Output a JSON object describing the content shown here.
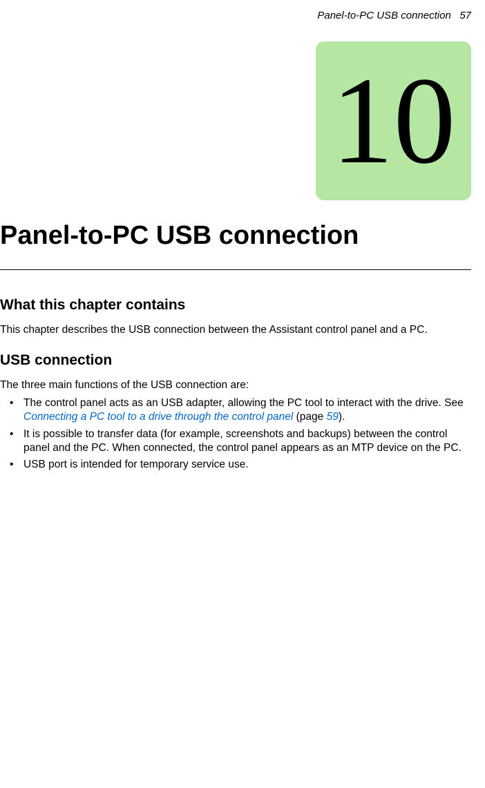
{
  "header": {
    "section_title": "Panel-to-PC USB connection",
    "page_number": "57"
  },
  "chapter": {
    "number": "10",
    "title": "Panel-to-PC USB connection"
  },
  "sections": {
    "what_contains": {
      "heading": "What this chapter contains",
      "body": "This chapter describes the USB connection between the Assistant control panel and a PC."
    },
    "usb_connection": {
      "heading": "USB connection",
      "intro": "The three main functions of the USB connection are:",
      "bullets": [
        {
          "pre": "The control panel acts as an USB adapter, allowing the PC tool to interact with the drive. See ",
          "link_text": "Connecting a PC tool to a drive through the control panel",
          "mid": " (page ",
          "link_page": "59",
          "post": ")."
        },
        {
          "text": "It is possible to transfer data (for example, screenshots and backups) between the control panel and the PC. When connected, the control panel appears as an MTP device on the PC."
        },
        {
          "text": "USB port is intended for temporary service use."
        }
      ]
    }
  }
}
